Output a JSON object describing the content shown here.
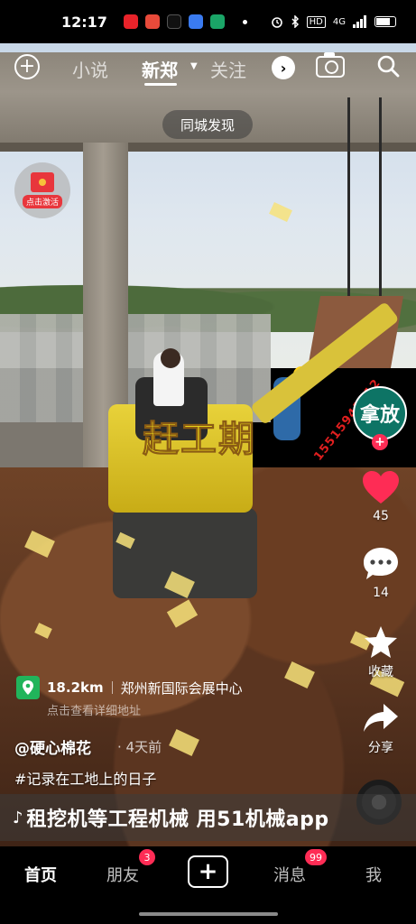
{
  "status_bar": {
    "time": "12:17",
    "network": "4G",
    "hd_label": "HD",
    "icons": [
      "youtube-icon",
      "redbook-icon",
      "tiktok-icon",
      "baidu-icon",
      "maps-icon",
      "alarm-icon",
      "bluetooth-icon",
      "signal-icon",
      "battery-icon"
    ]
  },
  "top_nav": {
    "tabs": [
      {
        "label": "小说",
        "active": false
      },
      {
        "label": "新郑",
        "active": true
      },
      {
        "label": "关注",
        "active": false
      }
    ],
    "more_icon": "chevron-right-icon"
  },
  "city_pill": "同城发现",
  "red_packet": {
    "label": "点击激活"
  },
  "video": {
    "overlay_title": "赶工期",
    "arm_text": "15515941012"
  },
  "right_rail": {
    "avatar_text": "拿放",
    "likes": "45",
    "comments": "14",
    "favorite_label": "收藏",
    "share_label": "分享",
    "like_color": "#fe2c55"
  },
  "location": {
    "distance": "18.2km",
    "name": "郑州新国际会展中心",
    "sub": "点击查看详细地址"
  },
  "author": "@硬心棉花",
  "time_ago": "· 4天前",
  "caption": "#记录在工地上的日子",
  "banner": {
    "text": "租挖机等工程机械  用51机械app"
  },
  "bottom_tabs": {
    "home": "首页",
    "friends": "朋友",
    "friends_badge": "3",
    "messages": "消息",
    "messages_badge": "99",
    "me": "我"
  },
  "colors": {
    "accent": "#fe2c55",
    "location_green": "#21b45b"
  }
}
